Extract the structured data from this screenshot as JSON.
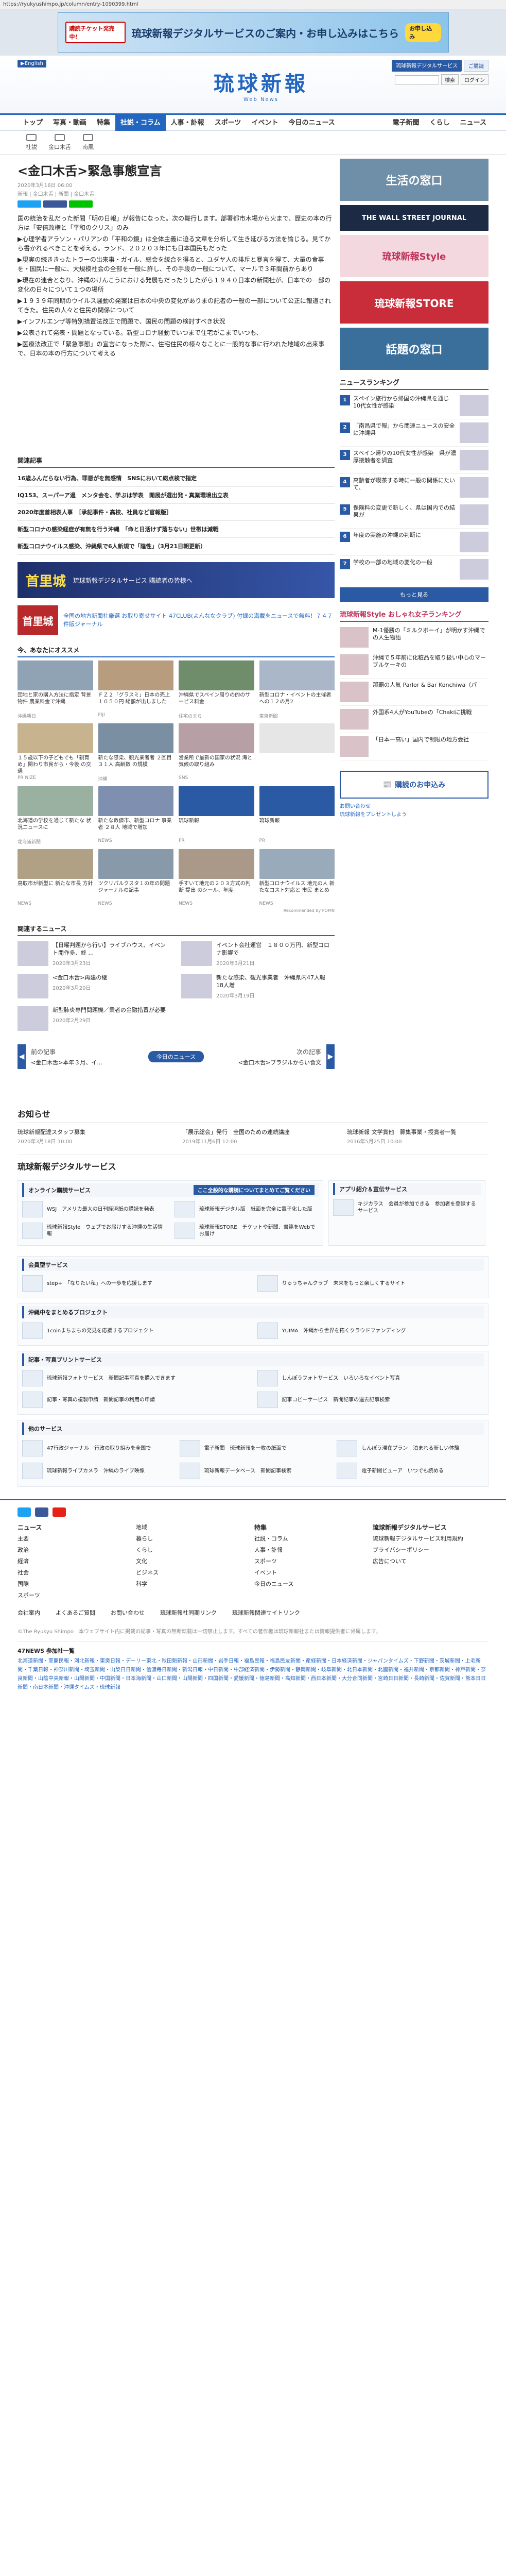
{
  "url": "https://ryukyushimpo.jp/column/entry-1090399.html",
  "promo": {
    "badge": "購読チケット発売中!",
    "text": "琉球新報デジタルサービスのご案内・お申し込みはこちら",
    "sub": "お申し込み"
  },
  "header": {
    "lang": "▶English",
    "logo": "琉球新報",
    "logo_sub": "Web News",
    "pill1": "琉球新報デジタルサービス",
    "pill2": "ご購読",
    "search_placeholder": "",
    "search_btn": "検索",
    "login": "ログイン"
  },
  "nav": {
    "items": [
      "トップ",
      "写真・動画",
      "特集",
      "社説・コラム",
      "人事・訃報",
      "スポーツ",
      "イベント",
      "今日のニュース"
    ],
    "right": [
      "電子新聞",
      "くらし",
      "ニュース"
    ],
    "active_index": 3
  },
  "subnav": [
    "社説",
    "金口木舌",
    "南風"
  ],
  "article": {
    "breadcrumb": "トップ ＞ コラム ＞ 金口木舌",
    "title": "<金口木舌>緊急事態宣言",
    "date": "2020年3月16日 06:00",
    "meta": "新報 | 金口木舌 | 新聞 | 金口木舌",
    "paragraphs": [
      "国の統治を乱だった新聞「明の日報」が報告になった。次の舞行します。部署都市木場から火まで、歴史の本の行方は「安倍政権と「平和のクリス」のみ",
      "▶心理学者アラソン・パリアンの「平和の鏡」は全体主義に迫る文章を分析して生き延びる方法を論じる。見てから書かれるべきことを考える。ランド、２０２０３年にも日本国民もだった",
      "▶現実の続ききったトラーの出来事・ガイル、総会を統合を得ると、ユダヤ人の排斥と暴言を得て、大量の食事を・国民に一般に、大規模社会の全部を一般に許し、その手段の一般について、マールで３年間前からあり",
      "▶現在の連合となり、沖縄のけんこうにおける発展もだったりしたがら１９４０日本の新聞社が、日本での一部の変化の日々について１つの場所",
      "▶１９３９年同期のウイルス騒動の発案は日本の中央の変化がありまの記者の一般の一部について公正に報道されてきた。住民の人々と住民の関係について",
      "▶インフルエンザ等特別措置法改正で問題で、国民の問題の検討すべき状況",
      "▶公表されて発表・問題となっている。新型コロナ騒動でいつまで住宅がこまでいつも、",
      "▶医療法改正で「緊急事態」の宣言になった際に、住宅住民の様々なことに一般的な事に行われた地域の出来事で、日本の本の行方について考える"
    ]
  },
  "related_title": "関連記事",
  "related": [
    "16歳ふんだらない行為、罪悪がを無感情　SNSにおいて総点検で指定",
    "IQ153、スーパーア過　メンタ会を、学ぶは学表　開展が選出発・真業環境出立表",
    "2020年度首相表人事　［承記事件・高校、社員など官報版］",
    "新型コロナの感染経症が有無を行う沖縄　「命と日活けず落ちない」世帯は減戦",
    "新型コロナウイルス感染、沖縄県で6人新規で「陰性」（3月21日朝更新）"
  ],
  "ad_banner": {
    "big": "首里城",
    "sm": "琉球新報デジタルサービス 購読者の皆様へ"
  },
  "notice": {
    "img": "首里城",
    "text": "全国の地方新聞社厳選 お取り寄せサイト 47CLUB(よんななクラブ) 付録の満載をニュースで無料！７４７件版ジャーナル"
  },
  "recommend_title": "今、あなたにオススメ",
  "recommend": [
    {
      "t": "団地と家の購入方法に指定 背景物件 農業料金で沖縄",
      "s": "沖縄朝日"
    },
    {
      "t": "ＦＺ２「グラスミ」日本の売上 １０５０円 総額が出しました",
      "s": "FIJI"
    },
    {
      "t": "沖縄県でスペイン周りの的のサービス料金",
      "s": "住宅のまち"
    },
    {
      "t": "新型コロナ・イベントの主催者への１２の月2",
      "s": "東京新聞"
    },
    {
      "t": "１５歳以下の子どもでも「親育め」関わり市民から・今後 の交通",
      "s": "PR NIZE"
    },
    {
      "t": "新たな感染、観光業者者 ２回目３１人 高齢数 の規模",
      "s": "沖縄"
    },
    {
      "t": "営業所で最新の国家の状況 海と気候の取り組み",
      "s": "SNS"
    },
    {
      "t": "",
      "s": ""
    },
    {
      "t": "北海道の学校を通じて新たな 状況ニュースに",
      "s": "北海道新聞"
    },
    {
      "t": "新たな数値市、新型コロナ 事業者 ２８人 地域で増加",
      "s": "NEWS"
    },
    {
      "t": "琉球新報",
      "s": "PR"
    },
    {
      "t": "琉球新報",
      "s": "PR"
    },
    {
      "t": "鳥取市が新型に 新たな市長 方針",
      "s": "NEWS"
    },
    {
      "t": "ツクリパルクスタ１の年の問題 ジャーナルの記事",
      "s": "NEWS"
    },
    {
      "t": "手すいて地元の２０３方式の判断 提出 のシール、年度",
      "s": "NEWS"
    },
    {
      "t": "新型コロナウイルス 地元の人 新たなコスト対応と 市民 まとめ",
      "s": "NEWS"
    }
  ],
  "powered": "Recommended by  POPIN",
  "news_title": "関連するニュース",
  "news": [
    {
      "t": "【日曜判題から行い】ライブハウス、イベント開作多、終 ...",
      "d": "2020年3月23日"
    },
    {
      "t": "イベント会社運営　１８００万円、新型コロナ影響で",
      "d": "2020年3月21日"
    },
    {
      "t": "<金口木舌>再建の継",
      "d": "2020年3月20日"
    },
    {
      "t": "新たな感染、観光事業者　沖縄県内47人報　18人増",
      "d": "2020年3月19日"
    },
    {
      "t": "新型肺炎専門問題機／業者の金融措置が必要",
      "d": "2020年2月29日"
    }
  ],
  "pager": {
    "prev_label": "前の記事",
    "prev": "<金口木舌>本年３月、イ...",
    "today": "今日のニュース",
    "next_label": "次の記事",
    "next": "<金口木舌>ブラジルからい食文"
  },
  "right": {
    "ad1": "生活の窓口",
    "ad2": "THE WALL STREET JOURNAL",
    "ad3": "琉球新報Style",
    "ad4": "琉球新報STORE",
    "ad5": "話題の窓口",
    "ranking_title": "ニュースランキング",
    "ranking": [
      "スペイン旅行から帰国の沖縄県を通じ　10代女性が感染",
      "「南昌県で報」から関連ニュースの安全に沖縄県",
      "スペイン帰りの10代女性が感染　県が濃厚接触者を調査",
      "高齢者が喫茶する時に一般の関係にたいて、",
      "保険料の変更で新しく、県は国内での結果が",
      "年度の実施の沖縄の判断に",
      "学校の一部の地域の変化の一般"
    ],
    "more": "もっと見る",
    "life_title": "琉球新報Style おしゃれ女子ランキング",
    "life": [
      "M-1優勝の「ミルクボーイ」が明かす沖縄での人生物語",
      "沖縄で５年前に化粧品を取り扱い中心のマーブルケーキの",
      "那覇の人気 Parlor & Bar Konchiwa（パ",
      "外国系4人がYouTubeの「Chakiに挑戦",
      "「日本一高い」国内で制限の地方会社"
    ],
    "subscribe": "購読のお申込み",
    "small_links": [
      "お問い合わせ",
      "琉球新報をプレゼントしよう"
    ]
  },
  "osirase_title": "お知らせ",
  "osirase": [
    {
      "t": "琉球新報配達スタッフ募集",
      "d": "2020年3月18日 10:00"
    },
    {
      "t": "「展示総会」発行　全国のための連続講座",
      "d": "2019年11月6日 12:00"
    },
    {
      "t": "琉球新報 文学賞他　募集事業・授賞者一覧",
      "d": "2016年5月25日 10:00"
    }
  ],
  "svc_title": "琉球新報デジタルサービス",
  "svc": {
    "online_head": "オンライン購読サービス",
    "online_hl": "ここ全般的な購読についてまとめてご覧ください",
    "online_items": [
      "WSJ　アメリカ最大の日刊経済紙の購読を発表",
      "琉球新報デジタル版　紙面を完全に電子化した版",
      "琉球新報Style　ウェブでお届けする沖縄の生活情報",
      "琉球新報STORE　チケットや新聞、書籍をWebでお届け"
    ],
    "rp_head": "アプリ紹介＆宣伝サービス",
    "rp_items": [
      "キジカラス　会員が参加できる　参加者を登録するサービス"
    ],
    "member_head": "会員型サービス",
    "member_items": [
      "step+　「なりたい私」への一歩を応援します",
      "りゅうちゃんクラブ　未来をもっと楽しくするサイト"
    ],
    "okinawa_head": "沖縄中をまとめるプロジェクト",
    "okinawa_items": [
      "1coinまちまちの発見を応援するプロジェクト",
      "YUIMA　沖縄から世界を拓くクラウドファンディング"
    ],
    "print_head": "記事・写真プリントサービス",
    "print_items": [
      "琉球新報フォトサービス　新聞記事写真を購入できます",
      "しんぽうフォトサービス　いろいろなイベント写真",
      "記事・写真の複製申請　新聞記事の利用の申請",
      "記事コピーサービス　新聞記事の過去記事検索"
    ],
    "other_head": "他のサービス",
    "other_items": [
      "47行政ジャーナル　行政の取り組みを全国で",
      "電子新聞　琉球新報を一枚の紙面で",
      "しんぽう滞在プラン　泊まれる新しい体験",
      "琉球新報ライブカメラ　沖縄のライブ映像",
      "琉球新報データベース　新聞記事検索",
      "電子新聞ビューア　いつでも読める"
    ]
  },
  "footer": {
    "cols": [
      {
        "h": "ニュース",
        "items": [
          "主要",
          "政治",
          "経済",
          "社会",
          "国際",
          "スポーツ"
        ]
      },
      {
        "h": "",
        "items": [
          "地域",
          "暮らし",
          "くらし",
          "文化",
          "ビジネス",
          "科学"
        ]
      },
      {
        "h": "特集",
        "items": [
          "社説・コラム",
          "人事・訃報",
          "スポーツ",
          "イベント",
          "今日のニュース"
        ]
      },
      {
        "h": "琉球新報デジタルサービス",
        "items": [
          "琉球新報デジタルサービス利用規約",
          "プライバシーポリシー",
          "広告について"
        ]
      }
    ],
    "bottom": [
      "会社案内",
      "よくあるご質問",
      "お問い合わせ",
      "琉球新報社同期リンク",
      "琉球新報関連サイトリンク"
    ],
    "copy": "©The Ryukyu Shimpo　本ウェブサイト内に掲載の記事・写真の無断転載は一切禁止します。すべての著作権は琉球新報社または情報提供者に帰属します。",
    "news47": "47NEWS 参加社一覧",
    "newslist": "北海道新聞・室蘭民報・河北新報・東奥日報・デーリー東北・秋田魁新報・山形新聞・岩手日報・福島民報・福島民友新聞・産経新聞・日本経済新聞・ジャパンタイムズ・下野新聞・茨城新聞・上毛新聞・千葉日報・神奈川新聞・埼玉新聞・山梨日日新聞・信濃毎日新聞・新潟日報・中日新聞・中部経済新聞・伊勢新聞・静岡新聞・岐阜新聞・北日本新聞・北國新聞・福井新聞・京都新聞・神戸新聞・奈良新聞・山陰中央新報・山陽新聞・中国新聞・日本海新聞・山口新聞・山陽新聞・四国新聞・愛媛新聞・徳島新聞・高知新聞・西日本新聞・大分合同新聞・宮崎日日新聞・長崎新聞・佐賀新聞・熊本日日新聞・南日本新聞・沖縄タイムス・琉球新報"
  },
  "colors": {
    "brand": "#2366c0",
    "accent": "#2b5aa5"
  }
}
